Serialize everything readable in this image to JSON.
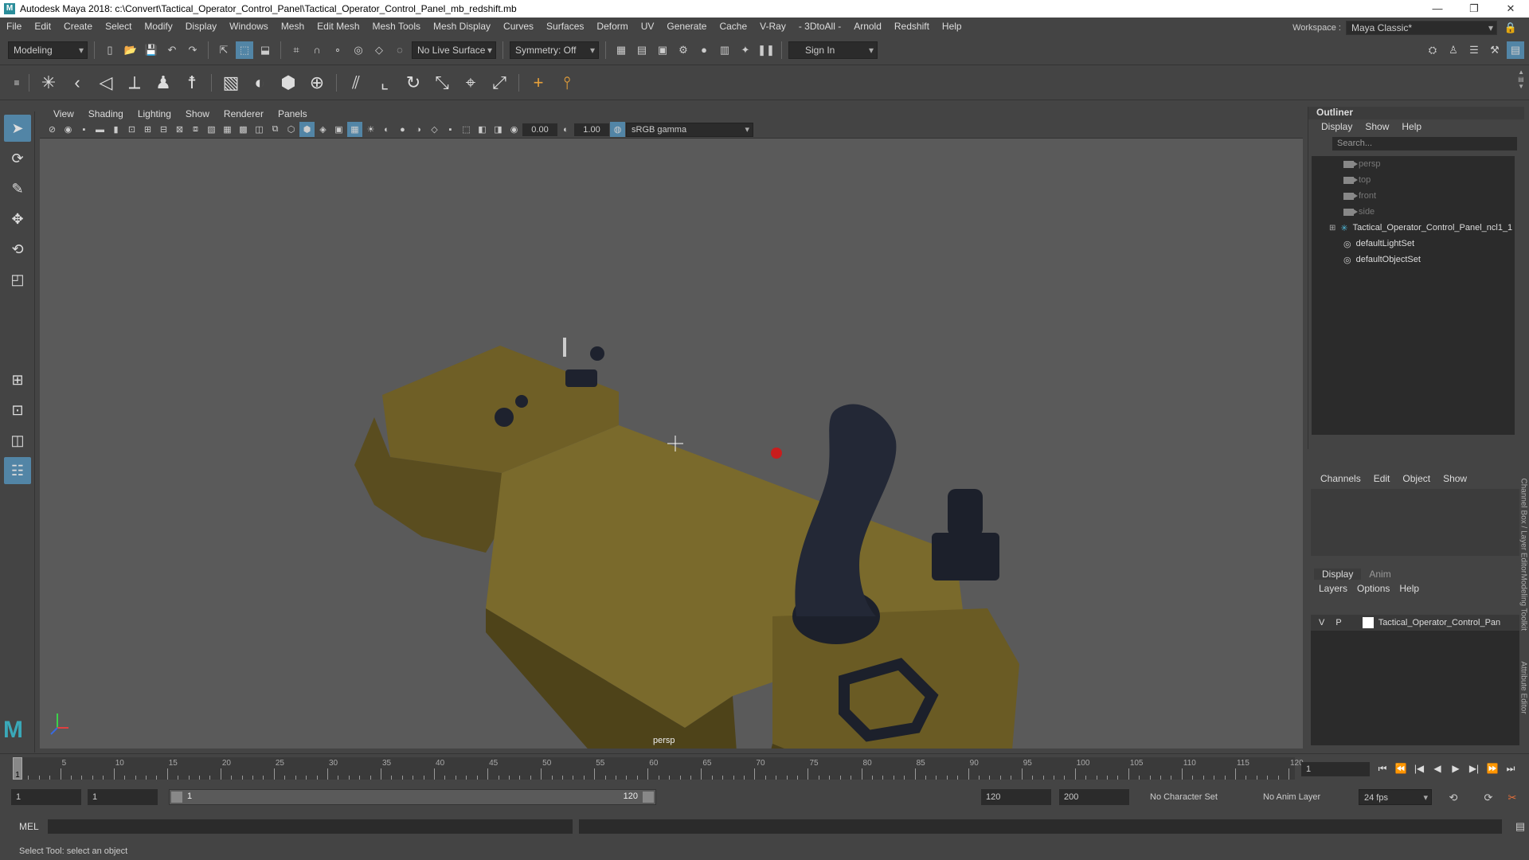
{
  "title": "Autodesk Maya 2018: c:\\Convert\\Tactical_Operator_Control_Panel\\Tactical_Operator_Control_Panel_mb_redshift.mb",
  "window_buttons": {
    "minimize": "—",
    "maximize": "❐",
    "close": "✕"
  },
  "menus": [
    "File",
    "Edit",
    "Create",
    "Select",
    "Modify",
    "Display",
    "Windows",
    "Mesh",
    "Edit Mesh",
    "Mesh Tools",
    "Mesh Display",
    "Curves",
    "Surfaces",
    "Deform",
    "UV",
    "Generate",
    "Cache",
    "V-Ray",
    "- 3DtoAll -",
    "Arnold",
    "Redshift",
    "Help"
  ],
  "workspace": {
    "label": "Workspace :",
    "value": "Maya Classic*"
  },
  "statusline": {
    "mode": "Modeling",
    "live_surface": "No Live Surface",
    "symmetry": "Symmetry: Off",
    "sign_in": "Sign In"
  },
  "viewport_menu": [
    "View",
    "Shading",
    "Lighting",
    "Show",
    "Renderer",
    "Panels"
  ],
  "viewport_toolbar": {
    "exposure": "0.00",
    "gamma": "1.00",
    "color_space": "sRGB gamma"
  },
  "viewport": {
    "camera": "persp"
  },
  "outliner": {
    "title": "Outliner",
    "menu": [
      "Display",
      "Show",
      "Help"
    ],
    "search_placeholder": "Search...",
    "items": [
      {
        "label": "persp",
        "icon": "camera-icon"
      },
      {
        "label": "top",
        "icon": "camera-icon"
      },
      {
        "label": "front",
        "icon": "camera-icon"
      },
      {
        "label": "side",
        "icon": "camera-icon"
      },
      {
        "label": "Tactical_Operator_Control_Panel_ncl1_1",
        "icon": "transform-icon"
      },
      {
        "label": "defaultLightSet",
        "icon": "set-icon"
      },
      {
        "label": "defaultObjectSet",
        "icon": "set-icon"
      }
    ]
  },
  "channel_box": {
    "menu": [
      "Channels",
      "Edit",
      "Object",
      "Show"
    ]
  },
  "layer_editor": {
    "tabs": [
      "Display",
      "Anim"
    ],
    "menu": [
      "Layers",
      "Options",
      "Help"
    ],
    "layer": {
      "v": "V",
      "p": "P",
      "name": "Tactical_Operator_Control_Pan"
    }
  },
  "side_tabs": [
    "Channel Box / Layer Editor",
    "Modeling Toolkit",
    "Attribute Editor"
  ],
  "timeline": {
    "ticks": [
      "5",
      "10",
      "15",
      "20",
      "25",
      "30",
      "35",
      "40",
      "45",
      "50",
      "55",
      "60",
      "65",
      "70",
      "75",
      "80",
      "85",
      "90",
      "95",
      "100",
      "105",
      "110",
      "115",
      "120"
    ],
    "current_marker": "1",
    "current_frame": "1",
    "playback": [
      "⏮",
      "⏪",
      "|◀",
      "◀",
      "▶",
      "▶|",
      "⏩",
      "⏭"
    ]
  },
  "range": {
    "start": "1",
    "playback_start": "1",
    "range_start": "1",
    "range_end": "120",
    "playback_end": "120",
    "end": "200",
    "character_set": "No Character Set",
    "anim_layer": "No Anim Layer",
    "fps": "24 fps"
  },
  "command_line": {
    "lang": "MEL"
  },
  "help_line": "Select Tool: select an object",
  "colors": {
    "accent": "#5285a6",
    "panel": "#444444",
    "field": "#2b2b2b",
    "viewport_bg": "#5a5a5a",
    "model_tan": "#7a6a2c",
    "model_dark": "#1d2230"
  }
}
